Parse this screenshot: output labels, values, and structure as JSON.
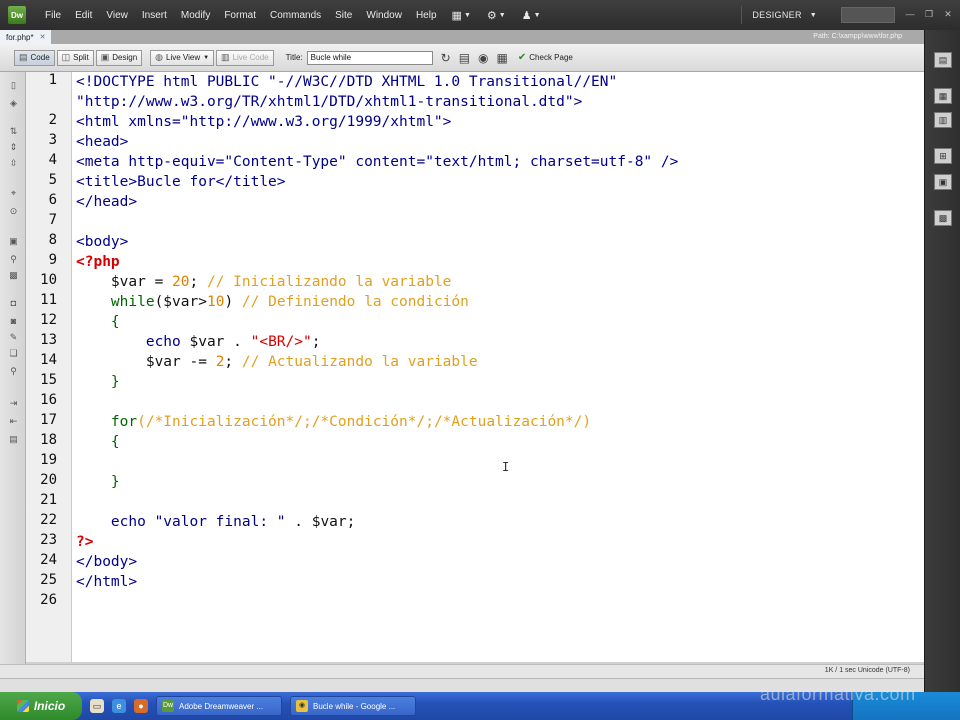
{
  "app": {
    "logo": "Dw",
    "menu": [
      "File",
      "Edit",
      "View",
      "Insert",
      "Modify",
      "Format",
      "Commands",
      "Site",
      "Window",
      "Help"
    ],
    "menu_icons": [
      "layout-icon",
      "gear-icon",
      "user-icon"
    ],
    "workspace": "DESIGNER"
  },
  "document": {
    "tab_name": "for.php*",
    "path": "Path: C:\\xampp\\www\\for.php"
  },
  "doc_toolbar": {
    "code": "Code",
    "split": "Split",
    "design": "Design",
    "live_view": "Live View",
    "live_code": "Live Code",
    "title_label": "Title:",
    "title_value": "Bucle while",
    "check_page": "Check Page"
  },
  "line_numbers": [
    "1",
    "",
    "2",
    "3",
    "4",
    "5",
    "6",
    "7",
    "8",
    "9",
    "10",
    "11",
    "12",
    "13",
    "14",
    "15",
    "16",
    "17",
    "18",
    "19",
    "20",
    "21",
    "22",
    "23",
    "24",
    "25",
    "26"
  ],
  "code": {
    "l1": "<!DOCTYPE html PUBLIC \"-//W3C//DTD XHTML 1.0 Transitional//EN\"",
    "l1b": "\"http://www.w3.org/TR/xhtml1/DTD/xhtml1-transitional.dtd\">",
    "l2": "<html xmlns=\"http://www.w3.org/1999/xhtml\">",
    "l3": "<head>",
    "l4": "<meta http-equiv=\"Content-Type\" content=\"text/html; charset=utf-8\" />",
    "l5": "<title>Bucle for</title>",
    "l6": "</head>",
    "l8": "<body>",
    "l9": "<?php",
    "l10_var": "    $var = ",
    "l10_num": "20",
    "l10_semi": "; ",
    "l10_cmt": "// Inicializando la variable",
    "l11_kw": "    while",
    "l11_cond": "($var>",
    "l11_num": "10",
    "l11_close": ") ",
    "l11_cmt": "// Definiendo la condición",
    "l12": "    {",
    "l13_echo": "        echo",
    "l13_rest": " $var . ",
    "l13_str": "\"<BR/>\"",
    "l13_semi": ";",
    "l14_var": "        $var -= ",
    "l14_num": "2",
    "l14_semi": "; ",
    "l14_cmt": "// Actualizando la variable",
    "l15": "    }",
    "l17_kw": "    for",
    "l17_open": "(",
    "l17_c1": "/*Inicialización*/",
    "l17_s1": ";",
    "l17_c2": "/*Condición*/",
    "l17_s2": ";",
    "l17_c3": "/*Actualización*/",
    "l17_close": ")",
    "l18": "    {",
    "l20": "    }",
    "l22_echo": "    echo",
    "l22_str": " \"valor final: \"",
    "l22_rest": " . $var;",
    "l23": "?>",
    "l24": "</body>",
    "l25": "</html>"
  },
  "status": {
    "text": "1K / 1 sec  Unicode (UTF-8)"
  },
  "taskbar": {
    "start": "Inicio",
    "tasks": [
      "Adobe Dreamweaver ...",
      "Bucle while - Google ..."
    ]
  },
  "watermark": "aulaformativa.com",
  "colors": {
    "tag": "#00008b",
    "php": "#d40000",
    "number": "#e08000",
    "comment": "#e0a020",
    "keyword": "#006400"
  }
}
